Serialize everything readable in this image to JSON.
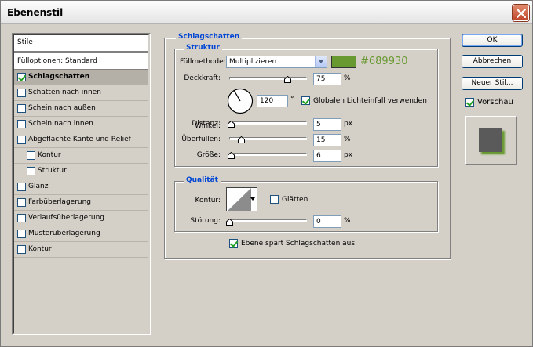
{
  "window": {
    "title": "Ebenenstil"
  },
  "sidebar": {
    "header": "Stile",
    "fill_options": "Fülloptionen: Standard",
    "items": [
      {
        "label": "Schlagschatten",
        "checked": true,
        "selected": true,
        "sub": false
      },
      {
        "label": "Schatten nach innen",
        "checked": false,
        "selected": false,
        "sub": false
      },
      {
        "label": "Schein nach außen",
        "checked": false,
        "selected": false,
        "sub": false
      },
      {
        "label": "Schein nach innen",
        "checked": false,
        "selected": false,
        "sub": false
      },
      {
        "label": "Abgeflachte Kante und Relief",
        "checked": false,
        "selected": false,
        "sub": false
      },
      {
        "label": "Kontur",
        "checked": false,
        "selected": false,
        "sub": true
      },
      {
        "label": "Struktur",
        "checked": false,
        "selected": false,
        "sub": true
      },
      {
        "label": "Glanz",
        "checked": false,
        "selected": false,
        "sub": false
      },
      {
        "label": "Farbüberlagerung",
        "checked": false,
        "selected": false,
        "sub": false
      },
      {
        "label": "Verlaufsüberlagerung",
        "checked": false,
        "selected": false,
        "sub": false
      },
      {
        "label": "Musterüberlagerung",
        "checked": false,
        "selected": false,
        "sub": false
      },
      {
        "label": "Kontur",
        "checked": false,
        "selected": false,
        "sub": false
      }
    ]
  },
  "main": {
    "section_title": "Schlagschatten",
    "structure": {
      "title": "Struktur",
      "blend_mode_label": "Füllmethode:",
      "blend_mode_value": "Multiplizieren",
      "color": "#689930",
      "color_hex_label": "#689930",
      "opacity_label": "Deckkraft:",
      "opacity_value": "75",
      "opacity_unit": "%",
      "opacity_level": 0.75,
      "angle_label": "Winkel:",
      "angle_value": "120",
      "angle_unit": "°",
      "global_light_label": "Globalen Lichteinfall verwenden",
      "global_light_checked": true,
      "distance_label": "Distanz:",
      "distance_value": "5",
      "distance_unit": "px",
      "distance_level": 0.02,
      "spread_label": "Überfüllen:",
      "spread_value": "15",
      "spread_unit": "%",
      "spread_level": 0.15,
      "size_label": "Größe:",
      "size_value": "6",
      "size_unit": "px",
      "size_level": 0.02
    },
    "quality": {
      "title": "Qualität",
      "contour_label": "Kontur:",
      "antialias_label": "Glätten",
      "antialias_checked": false,
      "noise_label": "Störung:",
      "noise_value": "0",
      "noise_unit": "%",
      "noise_level": 0
    },
    "knockout_label": "Ebene spart Schlagschatten aus",
    "knockout_checked": true
  },
  "buttons": {
    "ok": "OK",
    "cancel": "Abbrechen",
    "new_style": "Neuer Stil...",
    "preview_label": "Vorschau",
    "preview_checked": true
  }
}
